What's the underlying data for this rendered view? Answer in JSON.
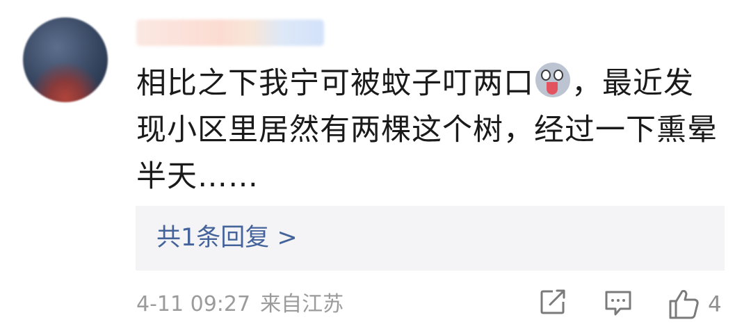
{
  "comment": {
    "username": "",
    "text_part1": "相比之下我宁可被蚊子叮两口",
    "emoji": "drooling-face-emoji",
    "text_part2": "，最近发现小区里居然有两棵这个树，经过一下熏晕半天……"
  },
  "replies": {
    "label": "共1条回复 >"
  },
  "meta": {
    "date": "4-11 09:27",
    "location": "来自江苏"
  },
  "actions": {
    "share_icon": "share-icon",
    "reply_icon": "comment-icon",
    "like_icon": "thumbs-up-icon",
    "like_count": "4"
  },
  "colors": {
    "text": "#1a1a1a",
    "link": "#44639a",
    "meta": "#9b9b9b",
    "reply_bg": "#f4f4f6"
  }
}
